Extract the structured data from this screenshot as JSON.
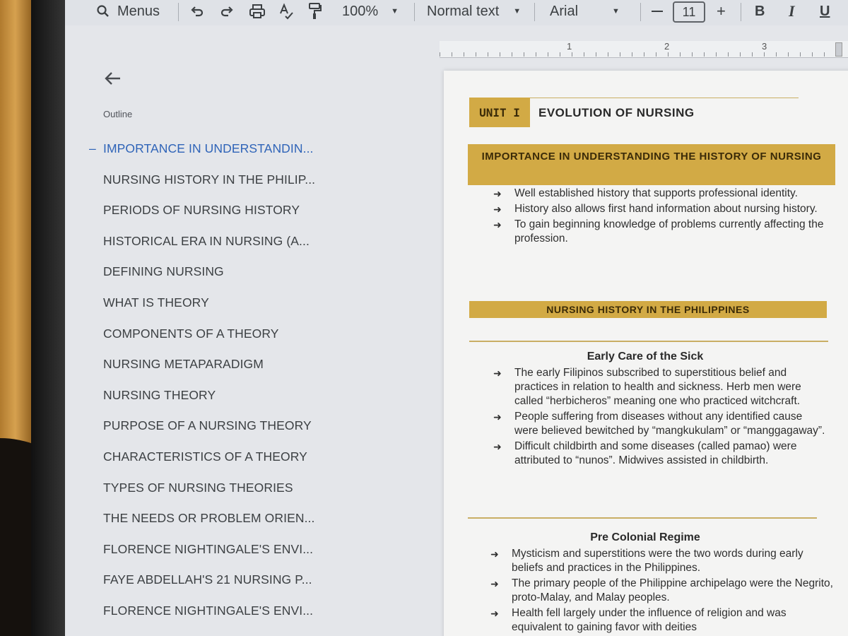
{
  "toolbar": {
    "search_label": "Menus",
    "zoom": "100%",
    "style": "Normal text",
    "font": "Arial",
    "font_size": "11",
    "bold": "B",
    "italic": "I",
    "underline": "U"
  },
  "ruler": {
    "marks": [
      "1",
      "2",
      "3"
    ]
  },
  "outline": {
    "title": "Outline",
    "items": [
      "IMPORTANCE IN UNDERSTANDIN...",
      "NURSING HISTORY IN THE PHILIP...",
      "PERIODS OF NURSING HISTORY",
      "HISTORICAL ERA IN NURSING (A...",
      "DEFINING NURSING",
      "WHAT IS THEORY",
      "COMPONENTS OF A THEORY",
      "NURSING METAPARADIGM",
      "NURSING THEORY",
      "PURPOSE OF A NURSING THEORY",
      "CHARACTERISTICS OF A THEORY",
      "TYPES OF NURSING THEORIES",
      "THE NEEDS OR PROBLEM ORIEN...",
      "FLORENCE NIGHTINGALE'S ENVI...",
      "FAYE ABDELLAH'S 21 NURSING P...",
      "FLORENCE NIGHTINGALE'S ENVI..."
    ]
  },
  "document": {
    "unit_label": "UNIT I",
    "unit_title": "EVOLUTION OF NURSING",
    "section1_title": "IMPORTANCE IN UNDERSTANDING THE HISTORY OF NURSING",
    "section1_bullets": [
      "Well established history that supports professional identity.",
      "History also allows first hand information about nursing history.",
      "To gain beginning knowledge of problems currently affecting the profession."
    ],
    "section2_title": "NURSING HISTORY IN THE PHILIPPINES",
    "early_care_title": "Early Care of the Sick",
    "early_care_bullets": [
      "The early Filipinos subscribed to superstitious belief and practices in relation to health and sickness. Herb men were called “herbicheros” meaning one who practiced witchcraft.",
      "People suffering from diseases without any identified cause were believed bewitched by “mangkukulam” or “manggagaway”.",
      "Difficult childbirth and some diseases (called pamao) were attributed to “nunos”. Midwives assisted in childbirth."
    ],
    "pre_colonial_title": "Pre Colonial Regime",
    "pre_colonial_bullets": [
      "Mysticism and superstitions were the two words during early beliefs and practices in the Philippines.",
      "The primary people of the Philippine archipelago were the Negrito, proto-Malay, and Malay peoples.",
      "Health fell largely under the influence of religion and was equivalent to gaining favor with deities"
    ]
  }
}
